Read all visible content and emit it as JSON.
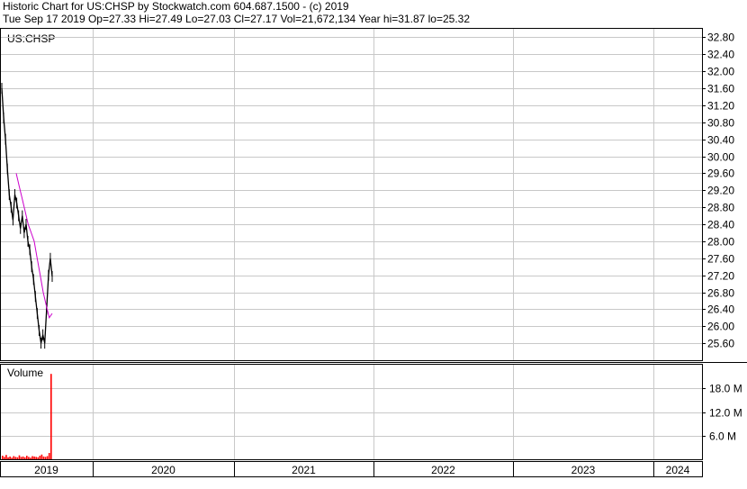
{
  "header": {
    "line1": "Historic Chart for US:CHSP by Stockwatch.com 604.687.1500 - (c) 2019",
    "line2": "Tue Sep 17 2019   Op=27.33   Hi=27.49   Lo=27.03   Cl=27.17   Vol=21,672,134   Year hi=31.87   lo=25.32"
  },
  "chart_data": [
    {
      "type": "line",
      "title": "US:CHSP",
      "y_ticks": [
        "32.80",
        "32.40",
        "32.00",
        "31.60",
        "31.20",
        "30.80",
        "30.40",
        "30.00",
        "29.60",
        "29.20",
        "28.80",
        "28.40",
        "28.00",
        "27.60",
        "27.20",
        "26.80",
        "26.40",
        "26.00",
        "25.60"
      ],
      "ylim": [
        25.2,
        33.0
      ],
      "x_ticks": [
        "2019",
        "2020",
        "2021",
        "2022",
        "2023",
        "2024"
      ],
      "grid": true,
      "series": [
        {
          "values": [
            31.6,
            30.9,
            30.4,
            29.7,
            29.1,
            28.8,
            28.5,
            29.1,
            28.9,
            28.6,
            28.3,
            28.6,
            28.2,
            28.4,
            28.0,
            27.8,
            27.4,
            27.1,
            26.7,
            26.3,
            25.9,
            25.6,
            25.8,
            25.6,
            26.4,
            27.2,
            27.6,
            27.17
          ]
        },
        {
          "values": [
            29.6,
            29.3,
            29.0,
            28.7,
            28.4,
            28.2,
            28.0,
            27.6,
            27.2,
            26.8,
            26.5,
            26.2,
            26.3
          ]
        }
      ]
    },
    {
      "type": "bar",
      "title": "Volume",
      "y_ticks": [
        "18.0 M",
        "12.0 M",
        "6.0 M"
      ],
      "ylim": [
        0,
        24
      ],
      "values": [
        0.9,
        0.6,
        1.1,
        0.5,
        0.7,
        0.4,
        0.8,
        0.6,
        0.5,
        1.0,
        0.6,
        0.7,
        0.5,
        0.9,
        0.6,
        0.4,
        0.8,
        0.7,
        0.6,
        0.5,
        0.9,
        1.2,
        0.7,
        0.6,
        0.8,
        1.6,
        21.67
      ]
    }
  ],
  "colors": {
    "grid": "#c8c8c8",
    "price": "#000000",
    "moving_average": "#cc00cc",
    "volume": "#ff0000"
  }
}
